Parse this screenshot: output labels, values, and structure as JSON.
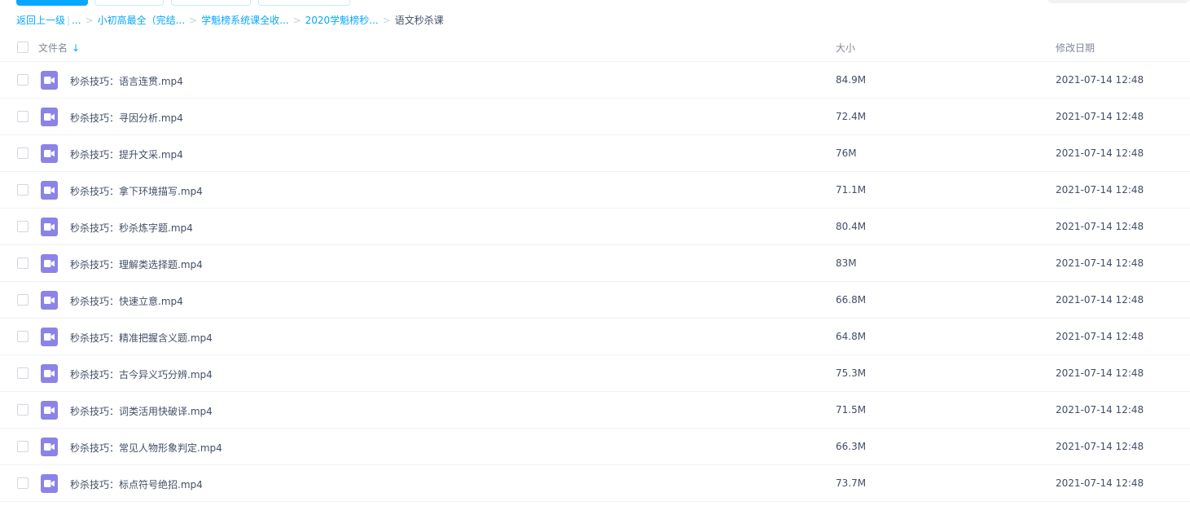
{
  "breadcrumb": {
    "back": "返回上一级",
    "ellipsis": "...",
    "items": [
      "小初高最全（完结...",
      "学魁榜系统课全收...",
      "2020学魁榜秒..."
    ],
    "current": "语文秒杀课"
  },
  "header": {
    "name": "文件名",
    "sort_arrow": "↓",
    "size": "大小",
    "date": "修改日期"
  },
  "colors": {
    "accent": "#06a7ff",
    "video_icon": "#8b83e8"
  },
  "files": [
    {
      "name": "秒杀技巧：语言连贯.mp4",
      "size": "84.9M",
      "date": "2021-07-14 12:48",
      "icon": "video-file-icon"
    },
    {
      "name": "秒杀技巧：寻因分析.mp4",
      "size": "72.4M",
      "date": "2021-07-14 12:48",
      "icon": "video-file-icon"
    },
    {
      "name": "秒杀技巧：提升文采.mp4",
      "size": "76M",
      "date": "2021-07-14 12:48",
      "icon": "video-file-icon"
    },
    {
      "name": "秒杀技巧：拿下环境描写.mp4",
      "size": "71.1M",
      "date": "2021-07-14 12:48",
      "icon": "video-file-icon"
    },
    {
      "name": "秒杀技巧：秒杀炼字题.mp4",
      "size": "80.4M",
      "date": "2021-07-14 12:48",
      "icon": "video-file-icon"
    },
    {
      "name": "秒杀技巧：理解类选择题.mp4",
      "size": "83M",
      "date": "2021-07-14 12:48",
      "icon": "video-file-icon"
    },
    {
      "name": "秒杀技巧：快速立意.mp4",
      "size": "66.8M",
      "date": "2021-07-14 12:48",
      "icon": "video-file-icon"
    },
    {
      "name": "秒杀技巧：精准把握含义题.mp4",
      "size": "64.8M",
      "date": "2021-07-14 12:48",
      "icon": "video-file-icon"
    },
    {
      "name": "秒杀技巧：古今异义巧分辨.mp4",
      "size": "75.3M",
      "date": "2021-07-14 12:48",
      "icon": "video-file-icon"
    },
    {
      "name": "秒杀技巧：词类活用快破译.mp4",
      "size": "71.5M",
      "date": "2021-07-14 12:48",
      "icon": "video-file-icon"
    },
    {
      "name": "秒杀技巧：常见人物形象判定.mp4",
      "size": "66.3M",
      "date": "2021-07-14 12:48",
      "icon": "video-file-icon"
    },
    {
      "name": "秒杀技巧：标点符号绝招.mp4",
      "size": "73.7M",
      "date": "2021-07-14 12:48",
      "icon": "video-file-icon"
    }
  ]
}
